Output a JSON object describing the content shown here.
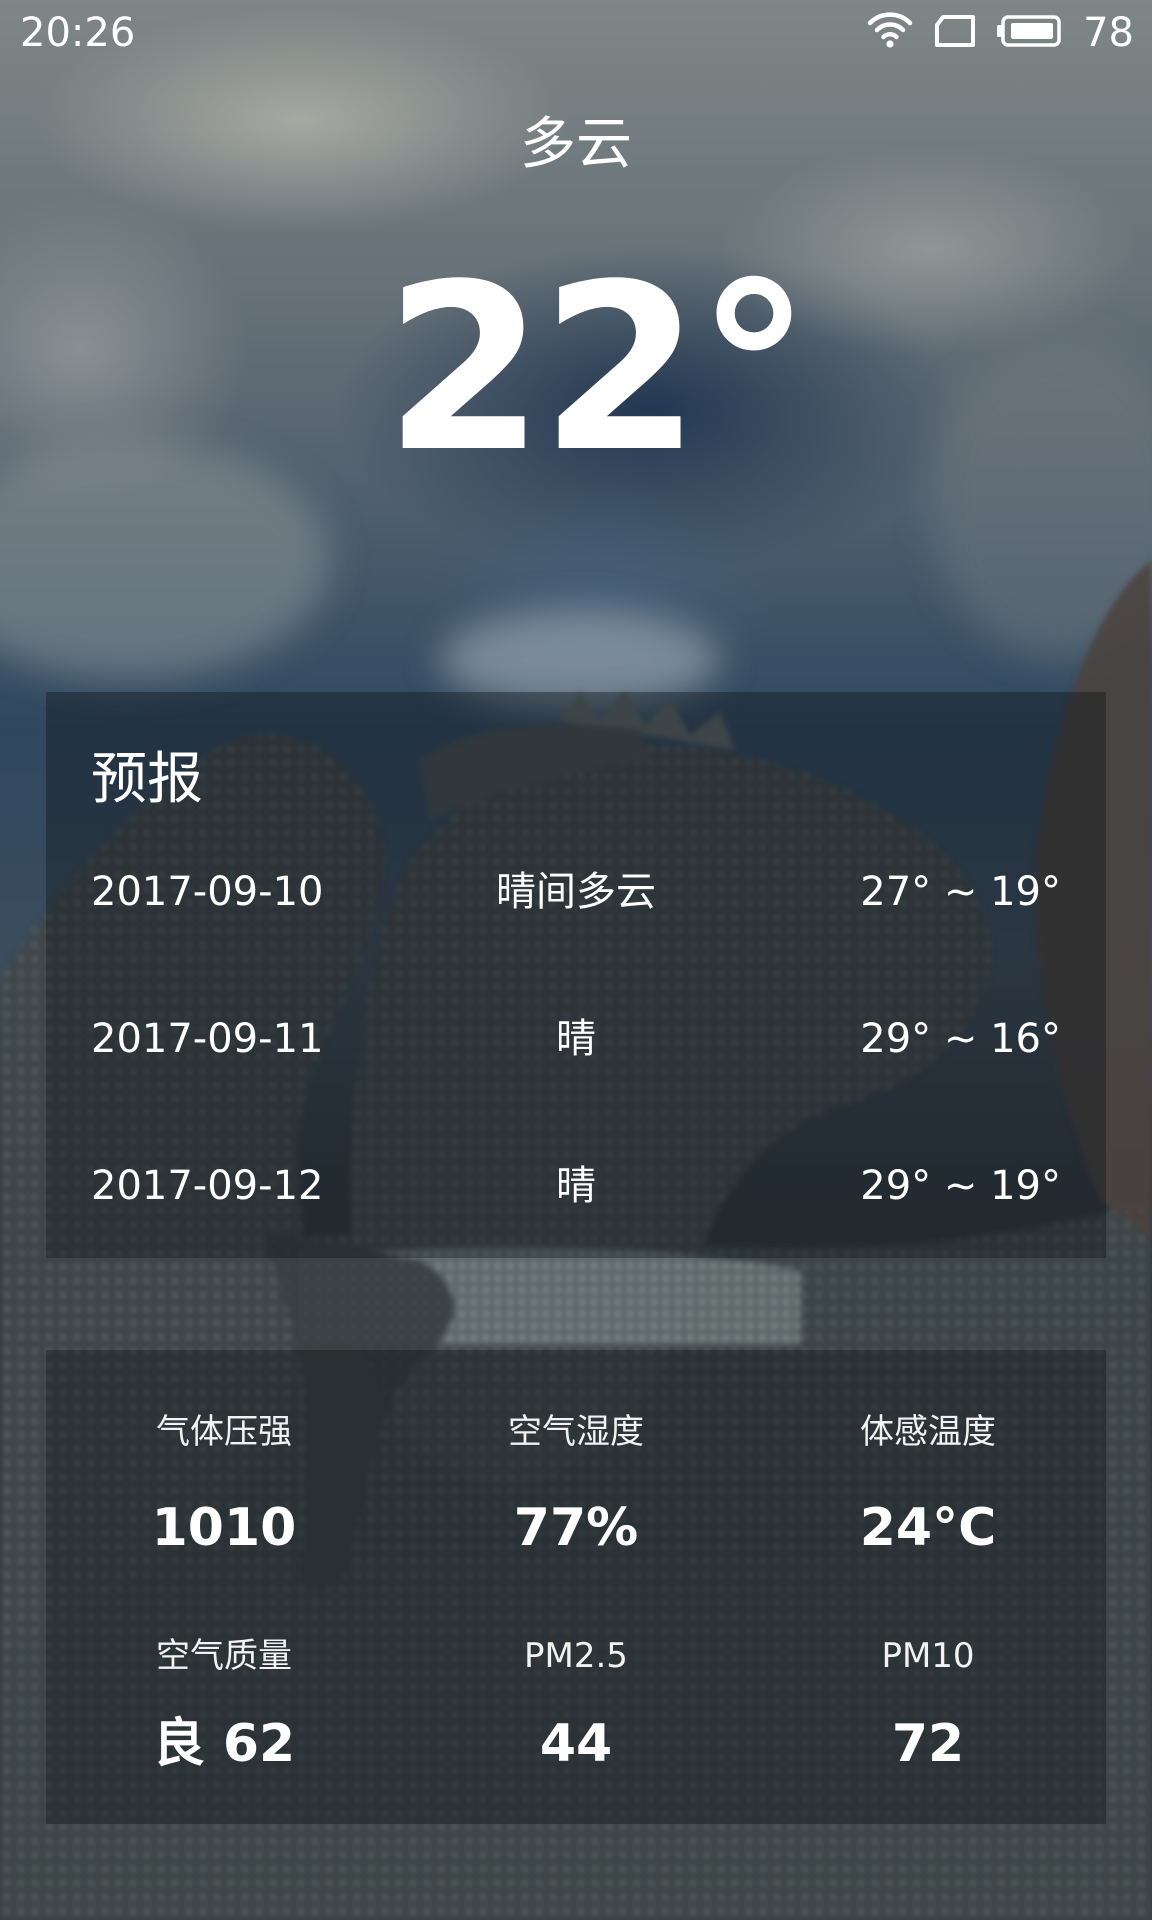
{
  "status_bar": {
    "time": "20:26",
    "battery_percent": "78",
    "icons": [
      "wifi-icon",
      "sim-card-icon",
      "battery-icon"
    ]
  },
  "current": {
    "description": "多云",
    "temperature": "22°"
  },
  "forecast": {
    "title": "预报",
    "days": [
      {
        "date": "2017-09-10",
        "condition": "晴间多云",
        "range": "27° ~ 19°"
      },
      {
        "date": "2017-09-11",
        "condition": "晴",
        "range": "29° ~ 16°"
      },
      {
        "date": "2017-09-12",
        "condition": "晴",
        "range": "29° ~ 19°"
      }
    ]
  },
  "details": [
    {
      "label": "气体压强",
      "value": "1010"
    },
    {
      "label": "空气湿度",
      "value": "77%"
    },
    {
      "label": "体感温度",
      "value": "24°C"
    },
    {
      "label": "空气质量",
      "value": "良 62"
    },
    {
      "label": "PM2.5",
      "value": "44"
    },
    {
      "label": "PM10",
      "value": "72"
    }
  ],
  "colors": {
    "text": "#ffffff",
    "panel": "rgba(20,24,28,0.42)"
  }
}
